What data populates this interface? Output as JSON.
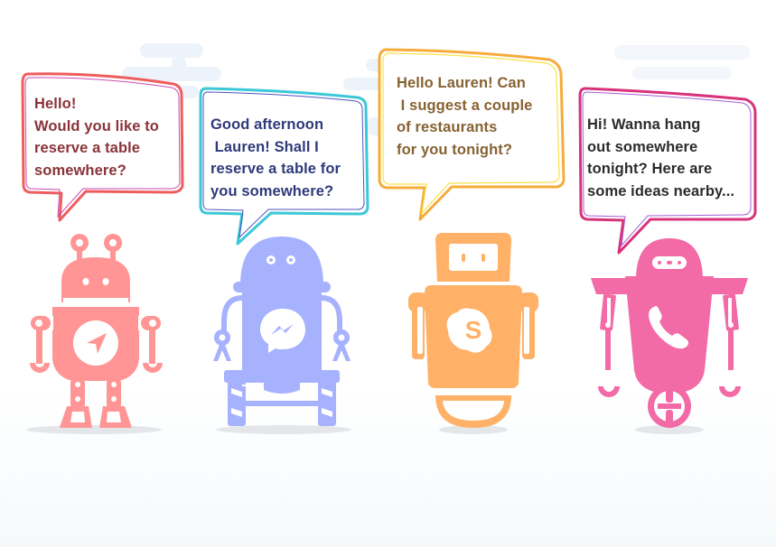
{
  "scene": {
    "description": "Four chatbot robots with speech bubbles",
    "background_color": "#ffffff"
  },
  "bots": [
    {
      "id": "telegram",
      "icon": "telegram-paper-plane-icon",
      "color": "#ff9595",
      "bubble_border": "#ee5d5d",
      "bubble_border_alt": "#c74bb0",
      "text_color": "#8a3338",
      "message": "Hello!\nWould you like to\nreserve a table\nsomewhere?"
    },
    {
      "id": "messenger",
      "icon": "messenger-icon",
      "color": "#a6b2fd",
      "bubble_border": "#3cc8d8",
      "bubble_border_alt": "#4d55c0",
      "text_color": "#2e3a7a",
      "message": "Good afternoon\n Lauren! Shall I\nreserve a table for\nyou somewhere?"
    },
    {
      "id": "skype",
      "icon": "skype-icon",
      "color": "#ffb168",
      "bubble_border": "#f5ac3b",
      "bubble_border_alt": "#f9e24b",
      "text_color": "#866232",
      "message": "Hello Lauren! Can\n I suggest a couple\nof restaurants\nfor you tonight?"
    },
    {
      "id": "phone",
      "icon": "phone-icon",
      "color": "#f26aa6",
      "bubble_border": "#d8337a",
      "bubble_border_alt": "#a35ed8",
      "text_color": "#2b2b2b",
      "message": "Hi! Wanna hang\nout somewhere\ntonight? Here are\nsome ideas nearby..."
    }
  ]
}
